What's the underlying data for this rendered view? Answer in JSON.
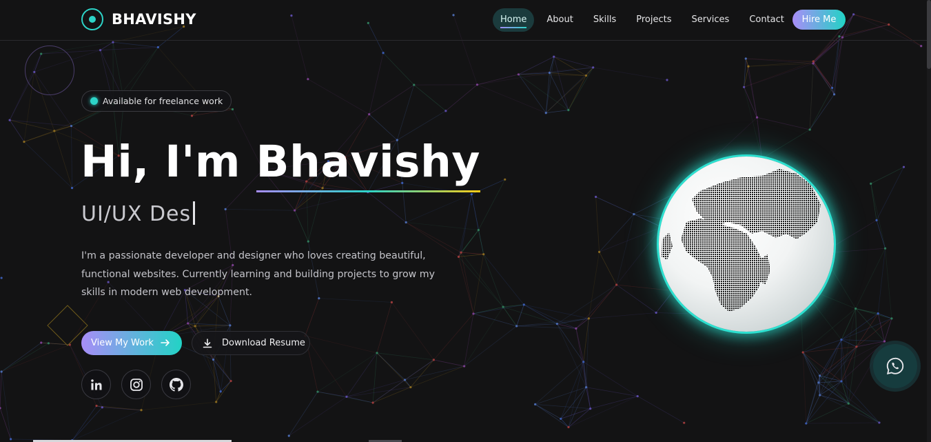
{
  "brand": {
    "name": "BHAVISHY"
  },
  "nav": {
    "links": [
      {
        "label": "Home",
        "active": true
      },
      {
        "label": "About",
        "active": false
      },
      {
        "label": "Skills",
        "active": false
      },
      {
        "label": "Projects",
        "active": false
      },
      {
        "label": "Services",
        "active": false
      },
      {
        "label": "Contact",
        "active": false
      }
    ],
    "hire_label": "Hire Me"
  },
  "hero": {
    "badge": "Available for freelance work",
    "greeting": "Hi, I'm",
    "name": "Bhavishy",
    "role_typed": "UI/UX Des",
    "description": "I'm a passionate developer and designer who loves creating beautiful, functional websites. Currently learning and building projects to grow my skills in modern web development.",
    "primary_button": "View My Work",
    "secondary_button": "Download Resume",
    "socials": [
      {
        "icon": "linkedin-icon"
      },
      {
        "icon": "instagram-icon"
      },
      {
        "icon": "github-icon"
      }
    ]
  },
  "colors": {
    "accent_teal": "#2dd4c8",
    "accent_purple": "#a88df7",
    "accent_yellow": "#facc15",
    "background": "#131314"
  },
  "icons": {
    "whatsapp": "whatsapp-icon",
    "globe": "globe-icon",
    "arrow": "arrow-right-icon",
    "download": "download-icon"
  }
}
